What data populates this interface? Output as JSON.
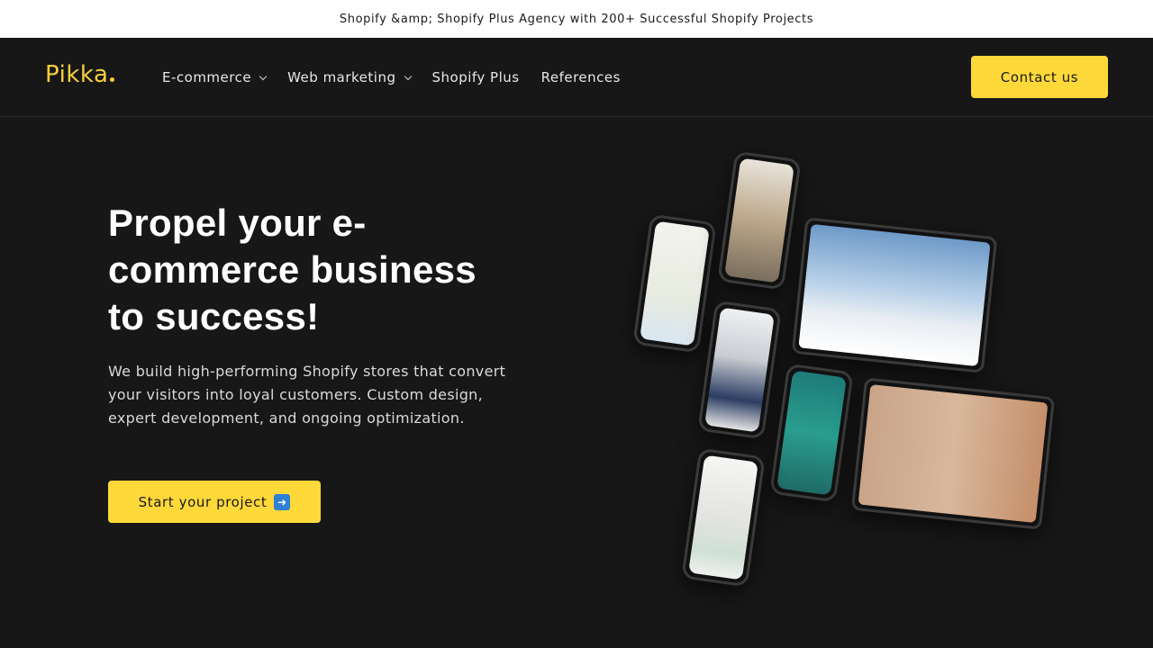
{
  "announcement": "Shopify &amp; Shopify Plus Agency with 200+ Successful Shopify Projects",
  "header": {
    "logo": "Pikka",
    "nav": [
      {
        "label": "E-commerce",
        "has_dropdown": true
      },
      {
        "label": "Web marketing",
        "has_dropdown": true
      },
      {
        "label": "Shopify Plus",
        "has_dropdown": false
      },
      {
        "label": "References",
        "has_dropdown": false
      }
    ],
    "contact_label": "Contact us"
  },
  "hero": {
    "title": "Propel your e-commerce business to success!",
    "text": "We build high-performing Shopify stores that convert your visitors into loyal customers. Custom design, expert development, and ongoing optimization.",
    "cta_label": "Start your project",
    "cta_icon": "right-arrow-emoji"
  },
  "colors": {
    "background": "#171717",
    "accent": "#ffd83a",
    "logo": "#f7cf3d",
    "announcement_bg": "#ffffff"
  }
}
